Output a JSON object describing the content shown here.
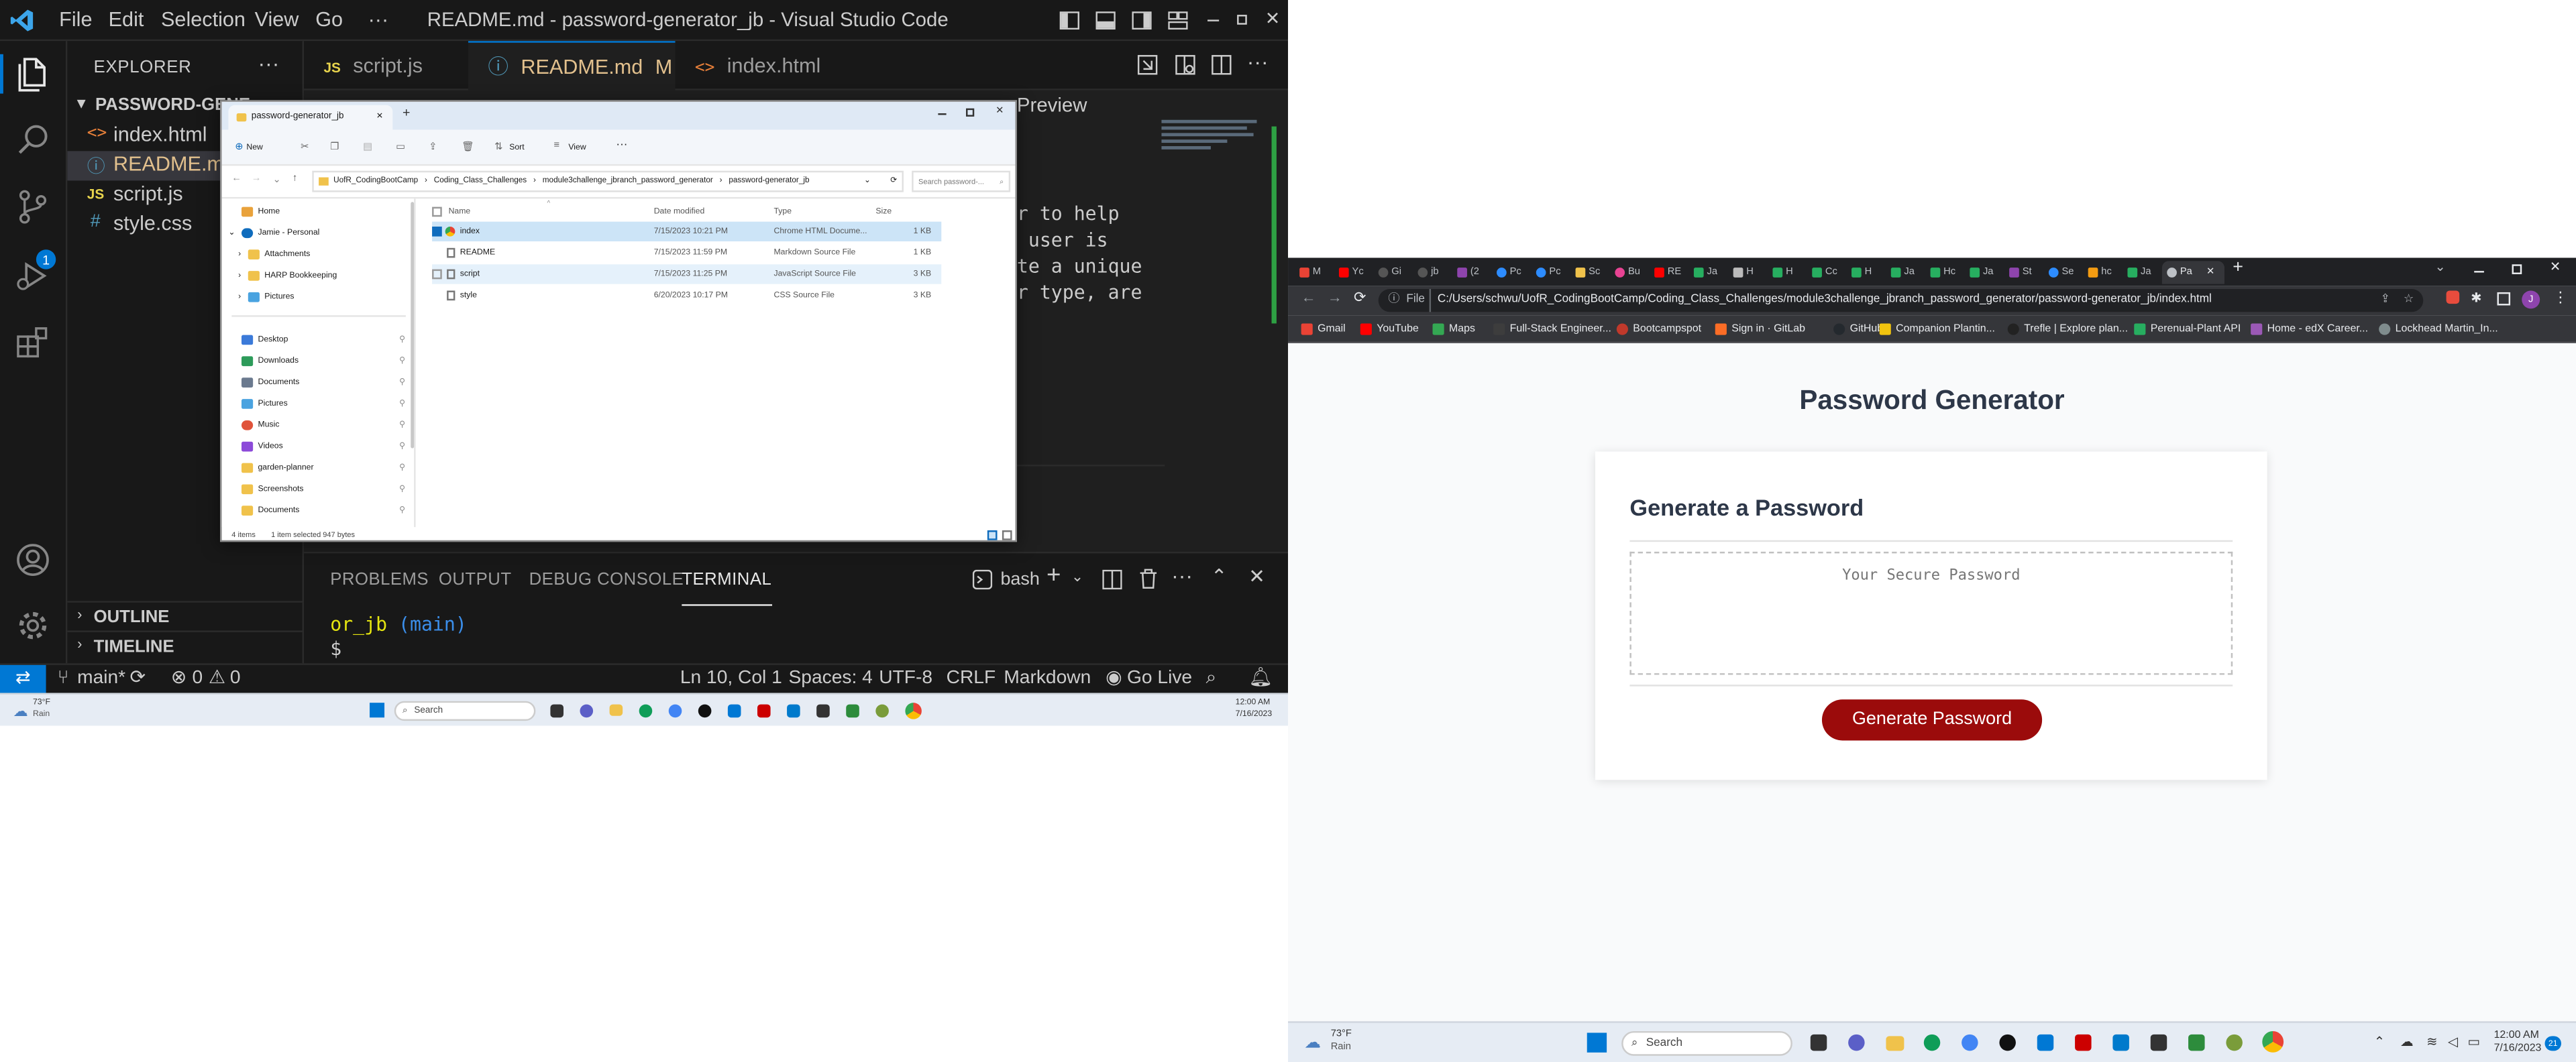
{
  "vscode": {
    "window_title": "README.md - password-generator_jb - Visual Studio Code",
    "menu": [
      "File",
      "Edit",
      "Selection",
      "View",
      "Go",
      "···"
    ],
    "sidebar": {
      "title": "EXPLORER",
      "folder": "PASSWORD-GENE",
      "files": [
        {
          "name": "index.html",
          "icon": "<>",
          "color": "#e8803a"
        },
        {
          "name": "README.md",
          "icon": "ⓘ",
          "color": "#519aba"
        },
        {
          "name": "script.js",
          "icon": "JS",
          "color": "#e8d44d"
        },
        {
          "name": "style.css",
          "icon": "#",
          "color": "#519aba"
        }
      ],
      "outline": "OUTLINE",
      "timeline": "TIMELINE"
    },
    "tabs": [
      {
        "name": "script.js",
        "icon": "JS"
      },
      {
        "name": "README.md",
        "icon": "ⓘ",
        "modified": "M"
      },
      {
        "name": "index.html",
        "icon": "<>"
      }
    ],
    "editor_fragments": {
      "preview": "Preview",
      "lines": [
        "r to help",
        " user is",
        "te a unique",
        "r type, are"
      ]
    },
    "panel": {
      "tabs": [
        "PROBLEMS",
        "OUTPUT",
        "DEBUG CONSOLE",
        "TERMINAL"
      ],
      "shell": "bash",
      "terminal_path": "or_jb",
      "terminal_branch": "(main)",
      "prompt": "$"
    },
    "activity_badge": "1",
    "status": {
      "branch": "main*",
      "errors": "0",
      "warnings": "0",
      "position": "Ln 10, Col 1",
      "spaces": "Spaces: 4",
      "encoding": "UTF-8",
      "eol": "CRLF",
      "language": "Markdown",
      "golive": "Go Live"
    }
  },
  "file_explorer": {
    "tab_title": "password-generator_jb",
    "toolbar": {
      "new": "New",
      "sort": "Sort",
      "view": "View",
      "more": "···"
    },
    "address": [
      "UofR_CodingBootCamp",
      "Coding_Class_Challenges",
      "module3challenge_jbranch_password_generator",
      "password-generator_jb"
    ],
    "search_placeholder": "Search password-...",
    "nav": [
      {
        "label": "Home",
        "color": "#e9a23b"
      },
      {
        "label": "Jamie - Personal",
        "color": "#0f6cbd"
      },
      {
        "label": "Attachments",
        "color": "#f0c24b"
      },
      {
        "label": "HARP Bookkeeping",
        "color": "#f0c24b"
      },
      {
        "label": "Pictures",
        "color": "#4aa3e0"
      },
      {
        "label": "Desktop",
        "color": "#3b7ad9"
      },
      {
        "label": "Downloads",
        "color": "#2d9b5a"
      },
      {
        "label": "Documents",
        "color": "#6b7a8f"
      },
      {
        "label": "Pictures",
        "color": "#4aa3e0"
      },
      {
        "label": "Music",
        "color": "#e0533a"
      },
      {
        "label": "Videos",
        "color": "#8c4ad9"
      },
      {
        "label": "garden-planner",
        "color": "#f0c24b"
      },
      {
        "label": "Screenshots",
        "color": "#f0c24b"
      },
      {
        "label": "Documents",
        "color": "#f0c24b"
      }
    ],
    "columns": [
      "Name",
      "Date modified",
      "Type",
      "Size"
    ],
    "files": [
      {
        "name": "index",
        "date": "7/15/2023 10:21 PM",
        "type": "Chrome HTML Docume...",
        "size": "1 KB"
      },
      {
        "name": "README",
        "date": "7/15/2023 11:59 PM",
        "type": "Markdown Source File",
        "size": "1 KB"
      },
      {
        "name": "script",
        "date": "7/15/2023 11:25 PM",
        "type": "JavaScript Source File",
        "size": "3 KB"
      },
      {
        "name": "style",
        "date": "6/20/2023 10:17 PM",
        "type": "CSS Source File",
        "size": "3 KB"
      }
    ],
    "status": {
      "items": "4 items",
      "selected": "1 item selected  947 bytes"
    }
  },
  "taskbar_left": {
    "weather_temp": "73°F",
    "weather_desc": "Rain",
    "search": "Search",
    "time": "12:00 AM",
    "date": "7/16/2023"
  },
  "taskbar_right": {
    "weather_temp": "73°F",
    "weather_desc": "Rain",
    "search": "Search",
    "time": "12:00 AM",
    "date": "7/16/2023",
    "badge": "21"
  },
  "chrome": {
    "tabs": [
      "M",
      "Yc",
      "Gi",
      "jb",
      "(2",
      "Pc",
      "Pc",
      "Sc",
      "Bu",
      "RE",
      "Ja",
      "H",
      "H",
      "Cc",
      "H",
      "Ja",
      "Hc",
      "Ja",
      "St",
      "Se",
      "hc",
      "Ja",
      "Pa"
    ],
    "url_prefix": "File",
    "url": "C:/Users/schwu/UofR_CodingBootCamp/Coding_Class_Challenges/module3challenge_jbranch_password_generator/password-generator_jb/index.html",
    "profile": "J",
    "bookmarks": [
      {
        "label": "Gmail",
        "color": "#ea4335"
      },
      {
        "label": "YouTube",
        "color": "#ff0000"
      },
      {
        "label": "Maps",
        "color": "#34a853"
      },
      {
        "label": "Full-Stack Engineer...",
        "color": "#3d3d3d"
      },
      {
        "label": "Bootcampspot",
        "color": "#c0392b"
      },
      {
        "label": "Sign in · GitLab",
        "color": "#fc6d26"
      },
      {
        "label": "GitHub",
        "color": "#24292e"
      },
      {
        "label": "Companion Plantin...",
        "color": "#f1c40f"
      },
      {
        "label": "Trefle | Explore plan...",
        "color": "#222222"
      },
      {
        "label": "Perenual-Plant API",
        "color": "#27ae60"
      },
      {
        "label": "Home - edX Career...",
        "color": "#9b59b6"
      },
      {
        "label": "Lockhead Martin_In...",
        "color": "#7f8c8d"
      }
    ],
    "page": {
      "header": "Password Generator",
      "card_title": "Generate a Password",
      "textarea_placeholder": "Your Secure Password",
      "button_label": "Generate Password"
    }
  }
}
